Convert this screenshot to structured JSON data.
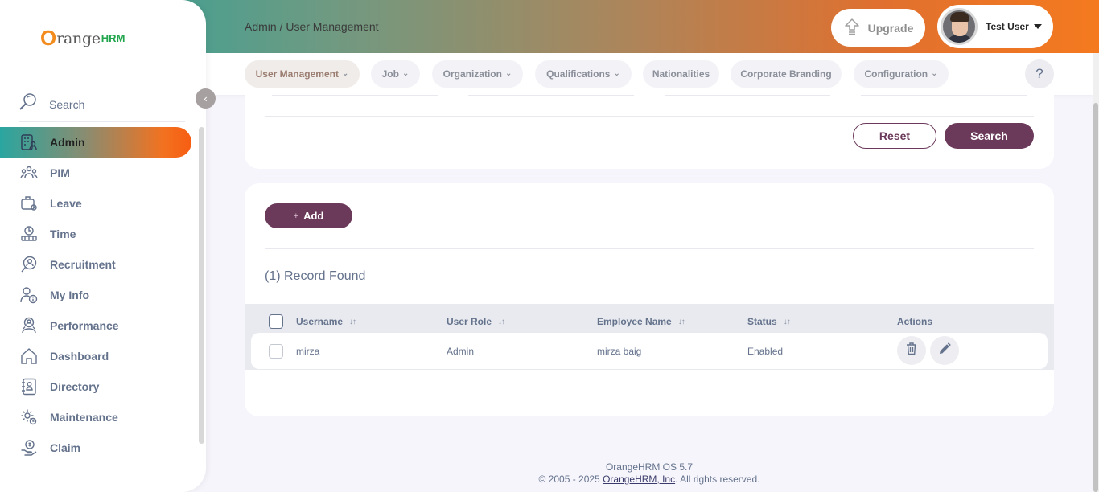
{
  "header": {
    "breadcrumb_module": "Admin",
    "breadcrumb_sep": " / ",
    "breadcrumb_page": "User Management",
    "upgrade_label": "Upgrade",
    "user_name": "Test User"
  },
  "topnav": {
    "items": [
      {
        "label": "User Management",
        "has_dropdown": true,
        "active": true
      },
      {
        "label": "Job",
        "has_dropdown": true
      },
      {
        "label": "Organization",
        "has_dropdown": true
      },
      {
        "label": "Qualifications",
        "has_dropdown": true
      },
      {
        "label": "Nationalities",
        "has_dropdown": false
      },
      {
        "label": "Corporate Branding",
        "has_dropdown": false
      },
      {
        "label": "Configuration",
        "has_dropdown": true
      }
    ],
    "help_label": "?"
  },
  "filters": {
    "reset_label": "Reset",
    "search_label": "Search"
  },
  "records": {
    "add_label": "Add",
    "count_text": "(1) Record Found",
    "columns": [
      "Username",
      "User Role",
      "Employee Name",
      "Status",
      "Actions"
    ],
    "rows": [
      {
        "username": "mirza",
        "role": "Admin",
        "employee": "mirza baig",
        "status": "Enabled"
      }
    ]
  },
  "sidebar": {
    "logo_o": "O",
    "logo_range": "range",
    "logo_hrm": "HRM",
    "search_label": "Search",
    "items": [
      {
        "label": "Admin",
        "icon": "admin-icon",
        "active": true
      },
      {
        "label": "PIM",
        "icon": "pim-icon"
      },
      {
        "label": "Leave",
        "icon": "leave-icon"
      },
      {
        "label": "Time",
        "icon": "time-icon"
      },
      {
        "label": "Recruitment",
        "icon": "recruitment-icon"
      },
      {
        "label": "My Info",
        "icon": "my-info-icon"
      },
      {
        "label": "Performance",
        "icon": "performance-icon"
      },
      {
        "label": "Dashboard",
        "icon": "dashboard-icon"
      },
      {
        "label": "Directory",
        "icon": "directory-icon"
      },
      {
        "label": "Maintenance",
        "icon": "maintenance-icon"
      },
      {
        "label": "Claim",
        "icon": "claim-icon"
      }
    ]
  },
  "footer": {
    "version": "OrangeHRM OS 5.7",
    "copyright_prefix": "© 2005 - 2025 ",
    "company_link": "OrangeHRM, Inc",
    "copyright_suffix": ". All rights reserved."
  },
  "colors": {
    "brand_purple": "#6b3a5b",
    "brand_orange": "#f57a1f",
    "brand_teal": "#1fa5a0",
    "text_muted": "#64728c"
  }
}
